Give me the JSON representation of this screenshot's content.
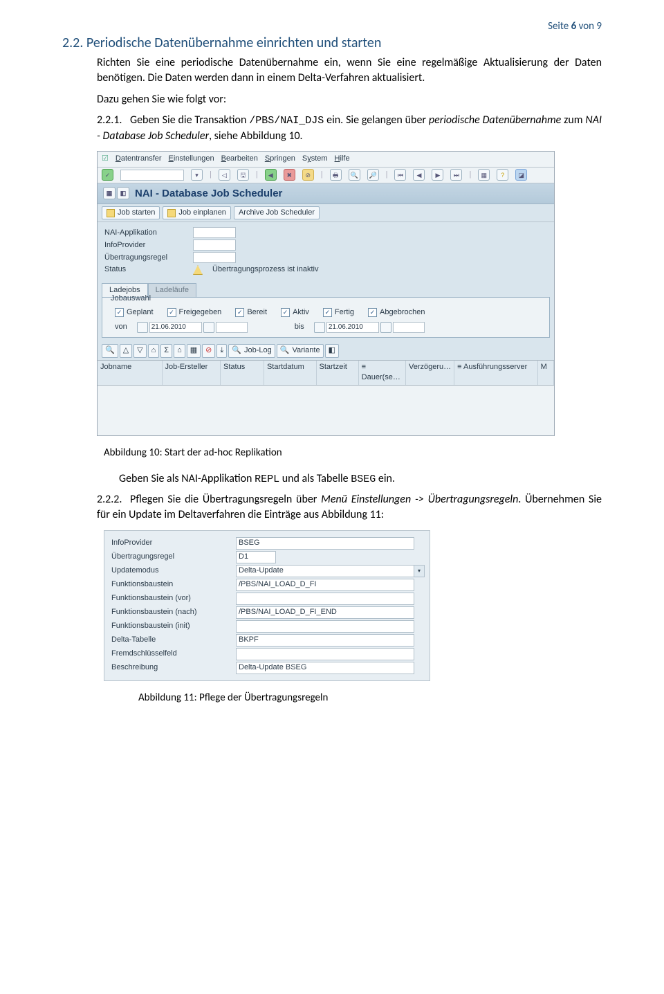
{
  "page_tag_l": "Seite ",
  "page_tag_bold": "6",
  "page_tag_r": " von 9",
  "heading_num": "2.2.",
  "heading": "Periodische Datenübernahme einrichten und starten",
  "para1a": "Richten Sie eine periodische Datenübernahme ein, wenn Sie eine regelmäßige Aktualisierung der Daten benötigen. Die Daten werden dann in einem Delta-Verfahren aktualisiert.",
  "para1b": "Dazu gehen Sie wie folgt vor:",
  "step221_num": "2.2.1.",
  "step221_a": "Geben  Sie  die  Transaktion ",
  "step221_code": "/PBS/NAI_DJS",
  "step221_b": " ein.  Sie  gelangen  über ",
  "step221_it1": "periodische Datenübernahme",
  "step221_c": " zum ",
  "step221_it2": "NAI - Database Job Scheduler",
  "step221_d": ", siehe Abbildung 10.",
  "sap1": {
    "menu": [
      "Datentransfer",
      "Einstellungen",
      "Bearbeiten",
      "Springen",
      "System",
      "Hilfe"
    ],
    "title": "NAI - Database Job Scheduler",
    "btn_start": "Job starten",
    "btn_plan": "Job einplanen",
    "btn_archive": "Archive Job Scheduler",
    "f_app": "NAI-Applikation",
    "f_ip": "InfoProvider",
    "f_ur": "Übertragungsregel",
    "f_st": "Status",
    "status_msg": "Übertragungsprozess ist inaktiv",
    "tab1": "Ladejobs",
    "tab2": "Ladeläufe",
    "gb_title": "Jobauswahl",
    "chk": [
      "Geplant",
      "Freigegeben",
      "Bereit",
      "Aktiv",
      "Fertig",
      "Abgebrochen"
    ],
    "lbl_von": "von",
    "lbl_bis": "bis",
    "date1": "21.06.2010",
    "date2": "21.06.2010",
    "btn_joblog": "Job-Log",
    "btn_variante": "Variante",
    "cols": [
      "Jobname",
      "Job-Ersteller",
      "Status",
      "Startdatum",
      "Startzeit",
      "≡ Dauer(se…",
      "Verzögeru…",
      "≡ Ausführungsserver",
      "M"
    ]
  },
  "fig10": "Abbildung 10: Start der ad-hoc Replikation",
  "line_input_a": "Geben Sie als NAI-Applikation ",
  "line_input_code1": "REPL",
  "line_input_b": " und als Tabelle ",
  "line_input_code2": "BSEG",
  "line_input_c": "  ein.",
  "step222_num": "2.2.2.",
  "step222_a": "Pflegen    Sie    die    Übertragungsregeln    über   ",
  "step222_it1": "Menü   Einstellungen   -> Übertragungsregeln",
  "step222_b": ". Übernehmen Sie für ein Update im Deltaverfahren die Einträge aus Abbildung 11:",
  "sap2": {
    "rows": [
      {
        "l": "InfoProvider",
        "v": "BSEG"
      },
      {
        "l": "Übertragungsregel",
        "v": "D1",
        "narrow": true
      },
      {
        "l": "Updatemodus",
        "v": "Delta-Update",
        "dd": true
      },
      {
        "l": "Funktionsbaustein",
        "v": "/PBS/NAI_LOAD_D_FI"
      },
      {
        "l": "Funktionsbaustein (vor)",
        "v": ""
      },
      {
        "l": "Funktionsbaustein (nach)",
        "v": "/PBS/NAI_LOAD_D_FI_END"
      },
      {
        "l": "Funktionsbaustein (init)",
        "v": ""
      },
      {
        "l": "Delta-Tabelle",
        "v": "BKPF"
      },
      {
        "l": "Fremdschlüsselfeld",
        "v": ""
      },
      {
        "l": "Beschreibung",
        "v": "Delta-Update BSEG"
      }
    ]
  },
  "fig11": "Abbildung 11: Pflege der Übertragungsregeln"
}
